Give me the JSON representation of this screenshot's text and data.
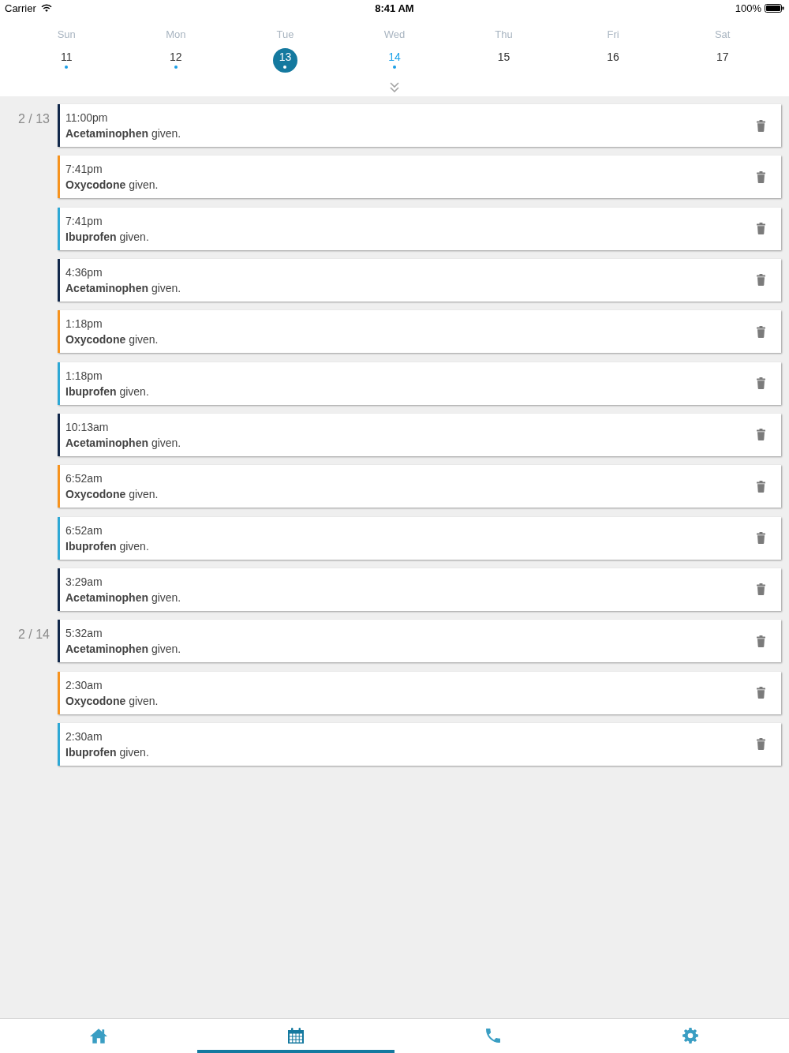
{
  "status_bar": {
    "carrier": "Carrier",
    "time": "8:41 AM",
    "battery": "100%"
  },
  "week": {
    "days": [
      {
        "weekday": "Sun",
        "date": "11",
        "has_entries": true,
        "selected": false,
        "today": false
      },
      {
        "weekday": "Mon",
        "date": "12",
        "has_entries": true,
        "selected": false,
        "today": false
      },
      {
        "weekday": "Tue",
        "date": "13",
        "has_entries": true,
        "selected": true,
        "today": false
      },
      {
        "weekday": "Wed",
        "date": "14",
        "has_entries": true,
        "selected": false,
        "today": true
      },
      {
        "weekday": "Thu",
        "date": "15",
        "has_entries": false,
        "selected": false,
        "today": false
      },
      {
        "weekday": "Fri",
        "date": "16",
        "has_entries": false,
        "selected": false,
        "today": false
      },
      {
        "weekday": "Sat",
        "date": "17",
        "has_entries": false,
        "selected": false,
        "today": false
      }
    ]
  },
  "log": [
    {
      "date": "2 / 13",
      "entries": [
        {
          "time": "11:00pm",
          "text": "**Acetaminophen** given.",
          "color": "#13294b"
        },
        {
          "time": "7:41pm",
          "text": "**Oxycodone** given.",
          "color": "#f7931e"
        },
        {
          "time": "7:41pm",
          "text": "**Ibuprofen** given.",
          "color": "#2ea8d5"
        },
        {
          "time": "4:36pm",
          "text": "**Acetaminophen** given.",
          "color": "#13294b"
        },
        {
          "time": "1:18pm",
          "text": "**Oxycodone** given.",
          "color": "#f7931e"
        },
        {
          "time": "1:18pm",
          "text": "**Ibuprofen** given.",
          "color": "#2ea8d5"
        },
        {
          "time": "10:13am",
          "text": "**Acetaminophen** given.",
          "color": "#13294b"
        },
        {
          "time": "6:52am",
          "text": "**Oxycodone** given.",
          "color": "#f7931e"
        },
        {
          "time": "6:52am",
          "text": "**Ibuprofen** given.",
          "color": "#2ea8d5"
        },
        {
          "time": "3:29am",
          "text": "**Acetaminophen** given.",
          "color": "#13294b"
        }
      ]
    },
    {
      "date": "2 / 14",
      "entries": [
        {
          "time": "5:32am",
          "text": "**Acetaminophen** given.",
          "color": "#13294b"
        },
        {
          "time": "2:30am",
          "text": "**Oxycodone** given.",
          "color": "#f7931e"
        },
        {
          "time": "2:30am",
          "text": "**Ibuprofen** given.",
          "color": "#2ea8d5"
        }
      ]
    }
  ],
  "tab_bar": {
    "tabs": [
      {
        "kind": "home",
        "selected": false
      },
      {
        "kind": "calendar",
        "selected": true
      },
      {
        "kind": "phone",
        "selected": false
      },
      {
        "kind": "settings",
        "selected": false
      }
    ]
  }
}
